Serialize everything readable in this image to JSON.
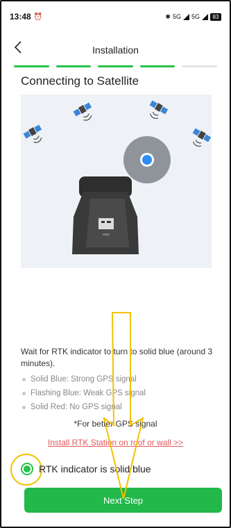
{
  "status_bar": {
    "time": "13:48",
    "battery": "83",
    "network": "5G"
  },
  "header": {
    "back_icon": "chevron-left-icon",
    "title": "Installation"
  },
  "progress": {
    "total_steps": 5,
    "completed_steps": 4
  },
  "page": {
    "section_title": "Connecting to Satellite"
  },
  "instructions": {
    "main": "Wait for RTK indicator to turn to solid blue (around 3 minutes).",
    "bullets": [
      "Solid Blue: Strong GPS signal",
      "Flashing Blue: Weak GPS signal",
      "Solid Red: No GPS signal"
    ],
    "tip": "*For better GPS signal",
    "link": "Install RTK Station on roof or wall >>"
  },
  "confirmation": {
    "label": "RTK indicator is solid blue",
    "checked": true
  },
  "footer": {
    "next_button": "Next Step"
  },
  "colors": {
    "accent": "#22b84a",
    "link": "#e2585a",
    "indicator_blue": "#2f8cf0",
    "annotation": "#f2c200"
  }
}
